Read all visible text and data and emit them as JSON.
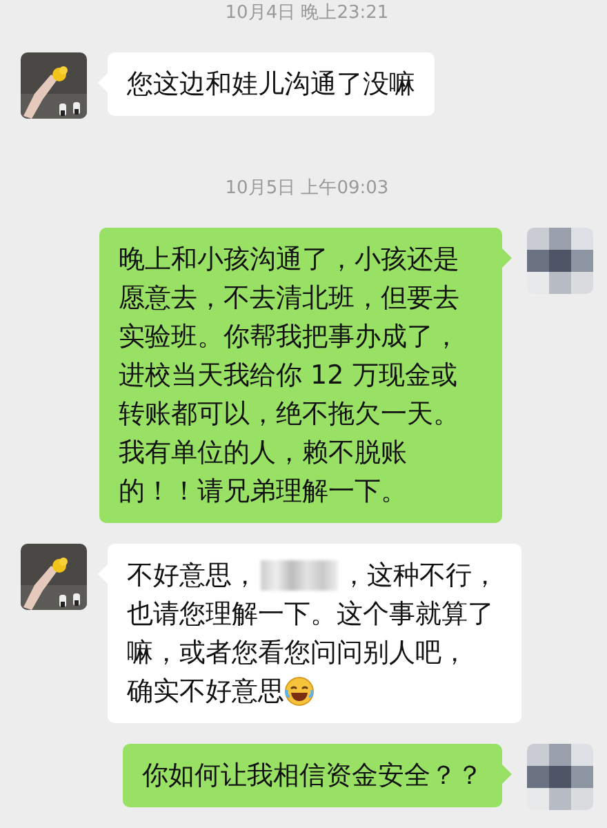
{
  "messages": [
    {
      "kind": "time",
      "text": "10月4日 晚上23:21"
    },
    {
      "kind": "received",
      "parts": [
        {
          "kind": "text",
          "text": "您这边和娃儿沟通了没嘛"
        }
      ]
    },
    {
      "kind": "time",
      "text": "10月5日 上午09:03"
    },
    {
      "kind": "sent",
      "parts": [
        {
          "kind": "text",
          "text": "晚上和小孩沟通了，小孩还是愿意去，不去清北班，但要去实验班。你帮我把事办成了，进校当天我给你 12 万现金或转账都可以，绝不拖欠一天。我有单位的人，赖不脱账的！！请兄弟理解一下。"
        }
      ]
    },
    {
      "kind": "received",
      "parts": [
        {
          "kind": "text",
          "text": "不好意思，"
        },
        {
          "kind": "redacted"
        },
        {
          "kind": "text",
          "text": "，这种不行，"
        },
        {
          "kind": "text",
          "text": "也请您理解一下。这个事就算了嘛，或者您看您问问别人吧，"
        },
        {
          "kind": "text",
          "text": "确实不好意思"
        },
        {
          "kind": "emoji"
        }
      ]
    },
    {
      "kind": "sent",
      "parts": [
        {
          "kind": "text",
          "text": "你如何让我相信资金安全？？"
        }
      ]
    }
  ]
}
